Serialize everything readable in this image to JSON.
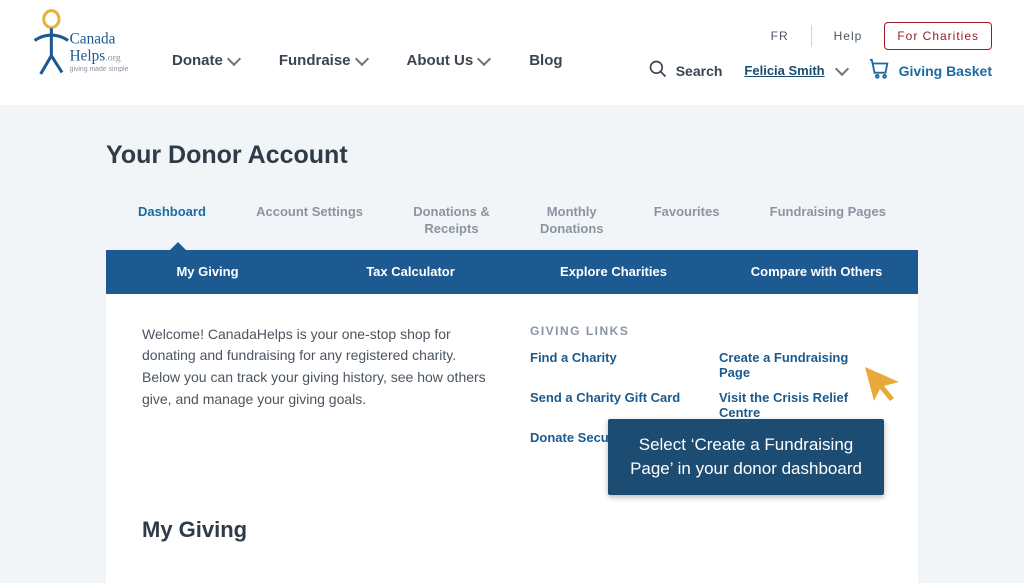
{
  "header": {
    "logo_line1": "Canada",
    "logo_line2": "Helps",
    "logo_tld": ".org",
    "logo_tagline": "giving made simple",
    "fr_link": "FR",
    "help_link": "Help",
    "for_charities": "For Charities",
    "nav": {
      "donate": "Donate",
      "fundraise": "Fundraise",
      "about": "About Us",
      "blog": "Blog"
    },
    "search_label": "Search",
    "user_name": "Felicia Smith",
    "basket_label": "Giving Basket"
  },
  "page": {
    "title": "Your Donor Account",
    "tabs": {
      "dashboard": "Dashboard",
      "account_settings": "Account Settings",
      "donations_receipts": "Donations & Receipts",
      "monthly_donations": "Monthly Donations",
      "favourites": "Favourites",
      "fundraising_pages": "Fundraising Pages"
    },
    "subnav": {
      "my_giving": "My Giving",
      "tax_calculator": "Tax Calculator",
      "explore_charities": "Explore Charities",
      "compare": "Compare with Others"
    },
    "welcome_text": "Welcome! CanadaHelps is your one-stop shop for donating and fundraising for any registered charity. Below you can track your giving history, see how others give, and manage your giving goals.",
    "giving_links_title": "GIVING LINKS",
    "links": {
      "find_charity": "Find a Charity",
      "create_fundraising": "Create a Fundraising Page",
      "send_gift_card": "Send a Charity Gift Card",
      "visit_crisis": "Visit the Crisis Relief Centre",
      "donate_securities": "Donate Securities"
    },
    "my_giving_heading": "My Giving"
  },
  "callout": {
    "text": "Select ‘Create a Fundraising Page’ in your donor dashboard"
  }
}
